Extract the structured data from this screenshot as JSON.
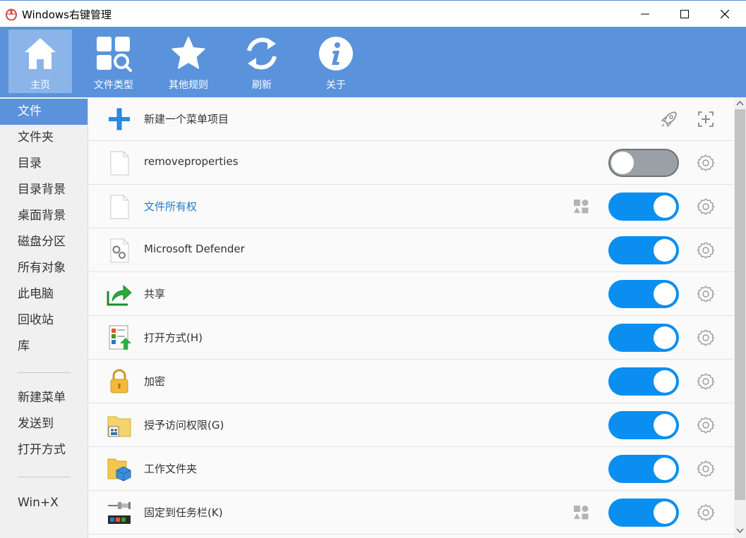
{
  "window": {
    "title": "Windows右键管理",
    "icon": "mouse-icon"
  },
  "toolbar": {
    "items": [
      {
        "label": "主页",
        "icon": "home-icon",
        "active": true
      },
      {
        "label": "文件类型",
        "icon": "file-types-icon",
        "active": false
      },
      {
        "label": "其他规则",
        "icon": "star-icon",
        "active": false
      },
      {
        "label": "刷新",
        "icon": "refresh-icon",
        "active": false
      },
      {
        "label": "关于",
        "icon": "info-icon",
        "active": false
      }
    ]
  },
  "sidebar": {
    "items": [
      {
        "label": "文件",
        "active": true
      },
      {
        "label": "文件夹"
      },
      {
        "label": "目录"
      },
      {
        "label": "目录背景"
      },
      {
        "label": "桌面背景"
      },
      {
        "label": "磁盘分区"
      },
      {
        "label": "所有对象"
      },
      {
        "label": "此电脑"
      },
      {
        "label": "回收站"
      },
      {
        "label": "库"
      },
      {
        "label": "新建菜单"
      },
      {
        "label": "发送到"
      },
      {
        "label": "打开方式"
      },
      {
        "label": "Win+X"
      }
    ]
  },
  "main": {
    "new_item": {
      "label": "新建一个菜单项目"
    },
    "rows": [
      {
        "label": "removeproperties",
        "enabled": false,
        "icon": "blank-file-icon",
        "shapes": false,
        "link": false
      },
      {
        "label": "文件所有权",
        "enabled": true,
        "icon": "blank-file-icon",
        "shapes": true,
        "link": true
      },
      {
        "label": "Microsoft Defender",
        "enabled": true,
        "icon": "gears-file-icon",
        "shapes": false,
        "link": false
      },
      {
        "label": "共享",
        "enabled": true,
        "icon": "share-icon",
        "shapes": false,
        "link": false
      },
      {
        "label": "打开方式(H)",
        "enabled": true,
        "icon": "open-with-icon",
        "shapes": false,
        "link": false
      },
      {
        "label": "加密",
        "enabled": true,
        "icon": "padlock-icon",
        "shapes": false,
        "link": false
      },
      {
        "label": "授予访问权限(G)",
        "enabled": true,
        "icon": "grant-access-icon",
        "shapes": false,
        "link": false
      },
      {
        "label": "工作文件夹",
        "enabled": true,
        "icon": "work-folder-icon",
        "shapes": false,
        "link": false
      },
      {
        "label": "固定到任务栏(K)",
        "enabled": true,
        "icon": "pin-taskbar-icon",
        "shapes": true,
        "link": false
      }
    ]
  },
  "colors": {
    "accent": "#5a93dc",
    "toggle_on": "#0a8ff0",
    "toggle_off": "#9aa0a6",
    "link": "#1e7dc9"
  }
}
